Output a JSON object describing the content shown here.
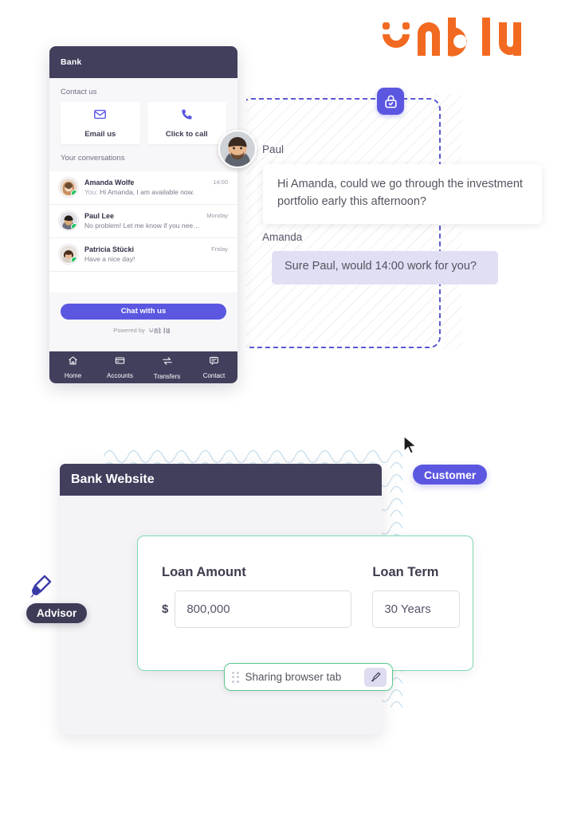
{
  "brand": {
    "logo_text": "unblu",
    "logo_color": "#f26a21",
    "accent_purple": "#5b57e0",
    "dark_navy": "#413f5c",
    "green": "#5cc98f",
    "online_green": "#22c55e"
  },
  "widget": {
    "header_title": "Bank",
    "contact_section_label": "Contact us",
    "contact_actions": [
      {
        "label": "Email us",
        "icon": "envelope-icon"
      },
      {
        "label": "Click to call",
        "icon": "phone-icon"
      }
    ],
    "conversations_label": "Your conversations",
    "conversations": [
      {
        "name": "Amanda Wolfe",
        "prefix": "You:",
        "preview": "Hi Amanda, I am available now.",
        "time": "14:00",
        "online": true
      },
      {
        "name": "Paul Lee",
        "prefix": "",
        "preview": "No problem! Let me know if you need...",
        "time": "Monday",
        "online": true
      },
      {
        "name": "Patricia Stücki",
        "prefix": "",
        "preview": "Have a nice day!",
        "time": "Friday",
        "online": true
      }
    ],
    "cta_label": "Chat with us",
    "powered_by_label": "Powered by",
    "powered_by_brand": "unblu",
    "nav": [
      {
        "label": "Home",
        "icon": "home-icon"
      },
      {
        "label": "Accounts",
        "icon": "card-icon"
      },
      {
        "label": "Transfers",
        "icon": "transfer-arrows-icon"
      },
      {
        "label": "Contact",
        "icon": "chat-bubble-icon"
      }
    ]
  },
  "conversation": {
    "secure_icon": "lock-check-icon",
    "messages": [
      {
        "sender": "Paul",
        "text": "Hi Amanda, could we go through the investment portfolio early this afternoon?",
        "side": "incoming"
      },
      {
        "sender": "Amanda",
        "text": "Sure Paul, would 14:00 work for you?",
        "side": "outgoing"
      }
    ]
  },
  "browser": {
    "header_title": "Bank Website",
    "form": {
      "fields": [
        {
          "label": "Loan Amount",
          "prefix": "$",
          "value": "800,000"
        },
        {
          "label": "Loan Term",
          "prefix": "",
          "value": "30 Years"
        }
      ]
    },
    "share_pill": {
      "drag_handle_icon": "drag-dots-icon",
      "label": "Sharing browser tab",
      "action_icon": "highlighter-pen-icon"
    }
  },
  "badges": {
    "customer": "Customer",
    "advisor": "Advisor",
    "advisor_cursor_icon": "highlighter-pen-cursor-icon",
    "customer_cursor_icon": "mouse-arrow-cursor-icon"
  }
}
